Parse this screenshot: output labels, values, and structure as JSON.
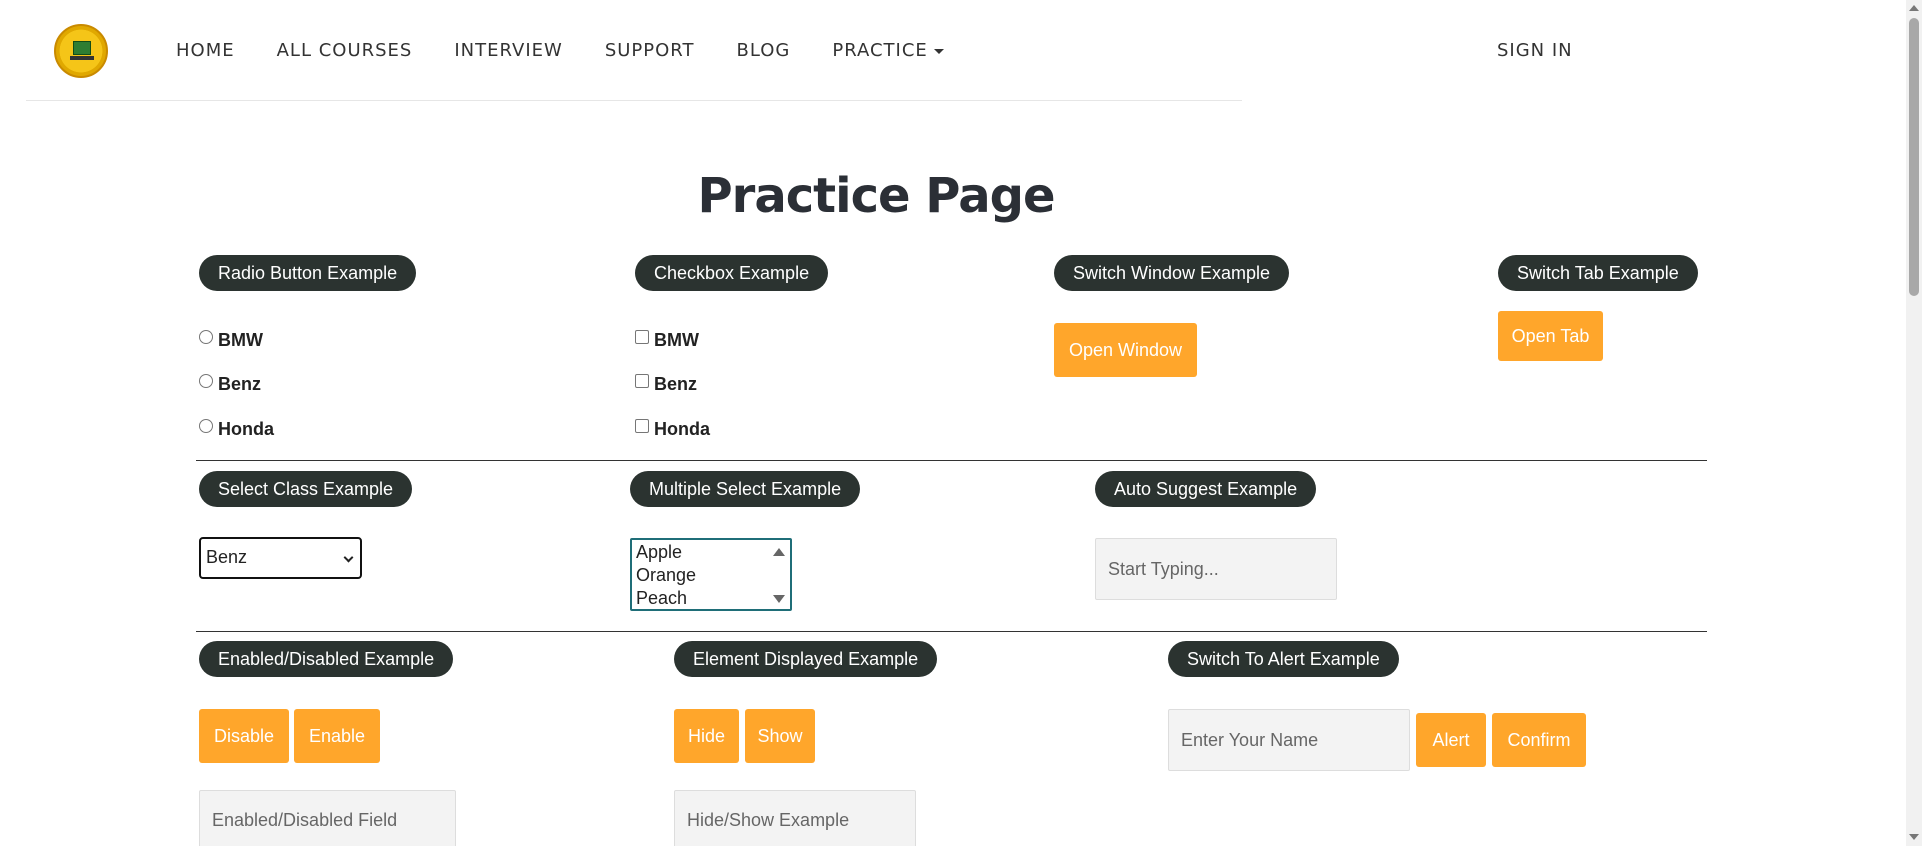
{
  "nav": {
    "items": [
      "HOME",
      "ALL COURSES",
      "INTERVIEW",
      "SUPPORT",
      "BLOG",
      "PRACTICE"
    ],
    "signin": "SIGN IN"
  },
  "page": {
    "title": "Practice Page"
  },
  "radio": {
    "legend": "Radio Button Example",
    "options": [
      "BMW",
      "Benz",
      "Honda"
    ]
  },
  "checkbox": {
    "legend": "Checkbox Example",
    "options": [
      "BMW",
      "Benz",
      "Honda"
    ]
  },
  "switch_window": {
    "legend": "Switch Window Example",
    "button": "Open Window"
  },
  "switch_tab": {
    "legend": "Switch Tab Example",
    "button": "Open Tab"
  },
  "select_class": {
    "legend": "Select Class Example",
    "selected": "Benz"
  },
  "multi_select": {
    "legend": "Multiple Select Example",
    "options": [
      "Apple",
      "Orange",
      "Peach"
    ]
  },
  "auto_suggest": {
    "legend": "Auto Suggest Example",
    "placeholder": "Start Typing..."
  },
  "enabled_disabled": {
    "legend": "Enabled/Disabled Example",
    "disable": "Disable",
    "enable": "Enable",
    "placeholder": "Enabled/Disabled Field"
  },
  "element_displayed": {
    "legend": "Element Displayed Example",
    "hide": "Hide",
    "show": "Show",
    "placeholder": "Hide/Show Example"
  },
  "alert": {
    "legend": "Switch To Alert Example",
    "placeholder": "Enter Your Name",
    "alert": "Alert",
    "confirm": "Confirm"
  },
  "colors": {
    "accent": "#ffa62b",
    "legend_bg": "#2b3330"
  }
}
